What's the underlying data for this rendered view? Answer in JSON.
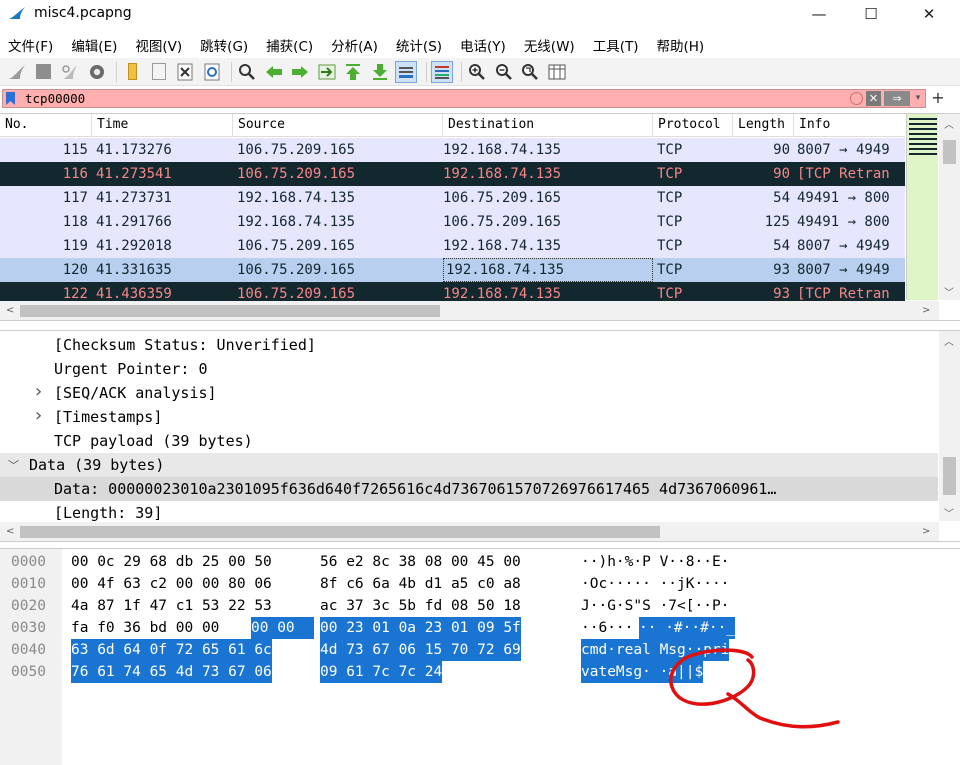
{
  "window": {
    "title": "misc4.pcapng",
    "minimize": "—",
    "maximize": "☐",
    "close": "✕"
  },
  "menu": [
    "文件(F)",
    "编辑(E)",
    "视图(V)",
    "跳转(G)",
    "捕获(C)",
    "分析(A)",
    "统计(S)",
    "电话(Y)",
    "无线(W)",
    "工具(T)",
    "帮助(H)"
  ],
  "toolbar_icons": [
    "shark-fin-start-icon",
    "stop-icon",
    "restart-icon",
    "options-gear-icon",
    "open-folder-icon",
    "file-icon",
    "close-file-icon",
    "reload-icon",
    "find-icon",
    "back-icon",
    "forward-icon",
    "go-to-packet-icon",
    "first-packet-icon",
    "last-packet-icon",
    "autoscroll-icon",
    "colorize-icon",
    "zoom-in-icon",
    "zoom-out-icon",
    "zoom-reset-icon",
    "resize-columns-icon"
  ],
  "filter": {
    "value": "tcp00000",
    "apply_arrow": "⇒",
    "add": "+"
  },
  "packet_list": {
    "columns": [
      "No.",
      "Time",
      "Source",
      "Destination",
      "Protocol",
      "Length",
      "Info"
    ],
    "rows": [
      {
        "no": "115",
        "time": "41.173276",
        "source": "106.75.209.165",
        "destination": "192.168.74.135",
        "protocol": "TCP",
        "length": "90",
        "info": "8007 → 4949",
        "style": "normal"
      },
      {
        "no": "116",
        "time": "41.273541",
        "source": "106.75.209.165",
        "destination": "192.168.74.135",
        "protocol": "TCP",
        "length": "90",
        "info": "[TCP Retran",
        "style": "dark"
      },
      {
        "no": "117",
        "time": "41.273731",
        "source": "192.168.74.135",
        "destination": "106.75.209.165",
        "protocol": "TCP",
        "length": "54",
        "info": "49491 → 800",
        "style": "normal"
      },
      {
        "no": "118",
        "time": "41.291766",
        "source": "192.168.74.135",
        "destination": "106.75.209.165",
        "protocol": "TCP",
        "length": "125",
        "info": "49491 → 800",
        "style": "normal"
      },
      {
        "no": "119",
        "time": "41.292018",
        "source": "106.75.209.165",
        "destination": "192.168.74.135",
        "protocol": "TCP",
        "length": "54",
        "info": "8007 → 4949",
        "style": "normal"
      },
      {
        "no": "120",
        "time": "41.331635",
        "source": "106.75.209.165",
        "destination": "192.168.74.135",
        "protocol": "TCP",
        "length": "93",
        "info": "8007 → 4949",
        "style": "selected"
      },
      {
        "no": "122",
        "time": "41.436359",
        "source": "106.75.209.165",
        "destination": "192.168.74.135",
        "protocol": "TCP",
        "length": "93",
        "info": "[TCP Retran",
        "style": "dark"
      }
    ]
  },
  "details": {
    "lines": [
      {
        "text": "[Checksum Status: Unverified]",
        "indent": 2,
        "expander": "",
        "style": ""
      },
      {
        "text": "Urgent Pointer: 0",
        "indent": 2,
        "expander": "",
        "style": ""
      },
      {
        "text": "[SEQ/ACK analysis]",
        "indent": 2,
        "expander": ">",
        "style": ""
      },
      {
        "text": "[Timestamps]",
        "indent": 2,
        "expander": ">",
        "style": ""
      },
      {
        "text": "TCP payload (39 bytes)",
        "indent": 2,
        "expander": "",
        "style": ""
      },
      {
        "text": "Data (39 bytes)",
        "indent": 1,
        "expander": "v",
        "style": "hl"
      },
      {
        "text": "Data: 00000023010a2301095f636d640f7265616c4d7367061570726976617465 4d7367060961…",
        "indent": 2,
        "expander": "",
        "style": "hl2"
      },
      {
        "text": "[Length: 39]",
        "indent": 2,
        "expander": "",
        "style": ""
      }
    ]
  },
  "bytes": {
    "rows": [
      {
        "offset": "0000",
        "hex_a": "00 0c 29 68 db 25 00 50",
        "hex_b": "56 e2 8c 38 08 00 45 00",
        "ascii": "··)h·%·P V··8··E·"
      },
      {
        "offset": "0010",
        "hex_a": "00 4f 63 c2 00 00 80 06",
        "hex_b": "8f c6 6a 4b d1 a5 c0 a8",
        "ascii": "·Oc····· ··jK····"
      },
      {
        "offset": "0020",
        "hex_a": "4a 87 1f 47 c1 53 22 53",
        "hex_b": "ac 37 3c 5b fd 08 50 18",
        "ascii": "J··G·S\"S ·7<[··P·"
      },
      {
        "offset": "0030",
        "hex_a": "fa f0 36 bd 00 00",
        "hex_a_sel": "00 00",
        "hex_b": "00 23 01 0a 23 01 09 5f",
        "ascii": "··6···",
        "ascii_sel": "·· ·#··#··_"
      },
      {
        "offset": "0040",
        "hex_a": "63 6d 64 0f 72 65 61 6c",
        "hex_b": "4d 73 67 06 15 70 72 69",
        "ascii": "cmd·real Msg··pri"
      },
      {
        "offset": "0050",
        "hex_a": "76 61 74 65 4d 73 67 06",
        "hex_b": "09 61 7c 7c 24",
        "ascii": "vateMsg· ·a||$"
      }
    ]
  },
  "colors": {
    "filter_invalid": "#ffafaf",
    "row_tcp": "#e7e6ff",
    "row_bad_tcp_bg": "#12272e",
    "row_bad_tcp_fg": "#f78787",
    "row_selected": "#b8cff0",
    "byte_selection": "#1a75d2",
    "annotation": "#e01010"
  }
}
